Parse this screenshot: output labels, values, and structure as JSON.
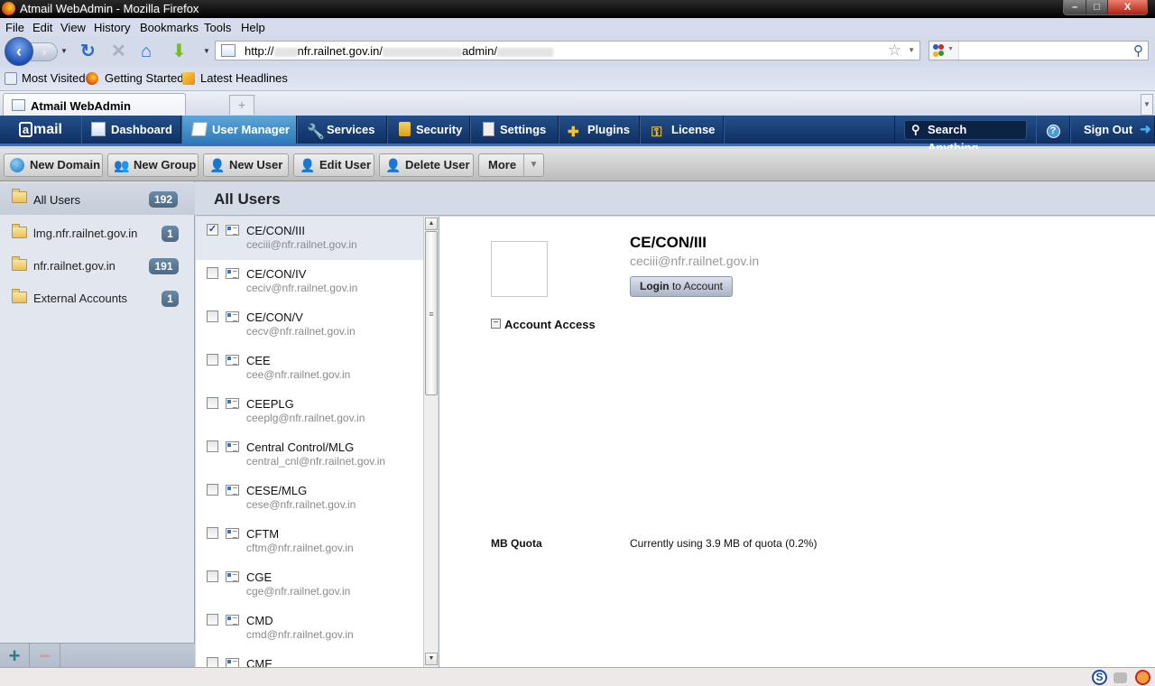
{
  "window": {
    "title": "Atmail WebAdmin - Mozilla Firefox",
    "controls": {
      "minimize": "–",
      "maximize": "□",
      "close": "X"
    }
  },
  "menu": [
    "File",
    "Edit",
    "View",
    "History",
    "Bookmarks",
    "Tools",
    "Help"
  ],
  "nav": {
    "url_prefix": "http://",
    "url_host": "nfr.railnet.gov.in/",
    "url_mid": "admin/",
    "search_placeholder": ""
  },
  "bookmarks": [
    "Most Visited",
    "Getting Started",
    "Latest Headlines"
  ],
  "tab": {
    "label": "Atmail WebAdmin",
    "new_tab": "+"
  },
  "app": {
    "logo": "mail",
    "logo_at": "a",
    "nav": [
      "Dashboard",
      "User Manager",
      "Services",
      "Security",
      "Settings",
      "Plugins",
      "License"
    ],
    "active_nav": "User Manager",
    "search": "Search Anything...",
    "help": "?",
    "sign_out": "Sign Out"
  },
  "toolbar": {
    "new_domain": "New Domain",
    "new_group": "New Group",
    "new_user": "New User",
    "edit_user": "Edit User",
    "delete_user": "Delete User",
    "more": "More"
  },
  "sidebar": {
    "items": [
      {
        "label": "All Users",
        "count": "192"
      },
      {
        "label": "lmg.nfr.railnet.gov.in",
        "count": "1"
      },
      {
        "label": "nfr.railnet.gov.in",
        "count": "191"
      },
      {
        "label": "External Accounts",
        "count": "1"
      }
    ],
    "add": "+",
    "remove": "−"
  },
  "main": {
    "heading": "All Users",
    "users": [
      {
        "name": "CE/CON/III",
        "email": "ceciii@nfr.railnet.gov.in",
        "checked": true
      },
      {
        "name": "CE/CON/IV",
        "email": "ceciv@nfr.railnet.gov.in",
        "checked": false
      },
      {
        "name": "CE/CON/V",
        "email": "cecv@nfr.railnet.gov.in",
        "checked": false
      },
      {
        "name": "CEE",
        "email": "cee@nfr.railnet.gov.in",
        "checked": false
      },
      {
        "name": "CEEPLG",
        "email": "ceeplg@nfr.railnet.gov.in",
        "checked": false
      },
      {
        "name": "Central Control/MLG",
        "email": "central_cnl@nfr.railnet.gov.in",
        "checked": false
      },
      {
        "name": "CESE/MLG",
        "email": "cese@nfr.railnet.gov.in",
        "checked": false
      },
      {
        "name": "CFTM",
        "email": "cftm@nfr.railnet.gov.in",
        "checked": false
      },
      {
        "name": "CGE",
        "email": "cge@nfr.railnet.gov.in",
        "checked": false
      },
      {
        "name": "CMD",
        "email": "cmd@nfr.railnet.gov.in",
        "checked": false
      },
      {
        "name": "CME",
        "email": "",
        "checked": false
      }
    ]
  },
  "detail": {
    "name": "CE/CON/III",
    "email": "ceciii@nfr.railnet.gov.in",
    "login_bold": "Login",
    "login_rest": " to Account",
    "account_access": "Account Access",
    "toggle": "−",
    "quota_label": "MB Quota",
    "quota_text": "Currently using 3.9 MB of quota (0.2%)"
  },
  "statusbar": {
    "icons": [
      "S",
      "",
      ""
    ]
  }
}
